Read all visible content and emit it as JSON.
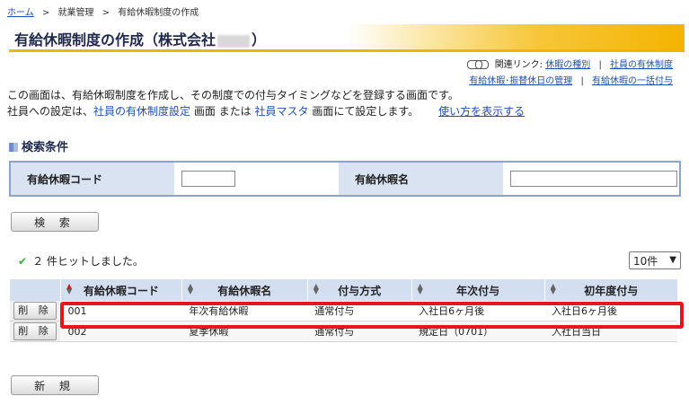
{
  "breadcrumb": {
    "home": "ホーム",
    "sep": ">",
    "level1": "就業管理",
    "current": "有給休暇制度の作成"
  },
  "header": {
    "title_prefix": "有給休暇制度の作成（株式会社",
    "title_suffix": "）"
  },
  "related": {
    "label": "関連リンク:",
    "links": [
      "休暇の種別",
      "社員の有休制度",
      "有給休暇･振替休日の管理",
      "有給休暇の一括付与"
    ],
    "separator": "|"
  },
  "description": {
    "line1": "この画面は、有給休暇制度を作成し、その制度での付与タイミングなどを登録する画面です。",
    "line2_a": "社員への設定は、",
    "line2_link1": "社員の有休制度設定",
    "line2_b": " 画面 または ",
    "line2_link2": "社員マスタ",
    "line2_c": " 画面にて設定します。",
    "howto": "使い方を表示する"
  },
  "search": {
    "section_title": "検索条件",
    "code_label": "有給休暇コード",
    "code_value": "",
    "name_label": "有給休暇名",
    "name_value": "",
    "search_button": "検 索"
  },
  "results": {
    "hit_text": "２ 件ヒットしました。",
    "per_page": "10件",
    "columns": [
      "有給休暇コード",
      "有給休暇名",
      "付与方式",
      "年次付与",
      "初年度付与"
    ],
    "delete_label": "削 除",
    "rows": [
      {
        "code": "001",
        "name": "年次有給休暇",
        "method": "通常付与",
        "annual": "入社日6ヶ月後",
        "first_year": "入社日6ヶ月後"
      },
      {
        "code": "002",
        "name": "夏季休暇",
        "method": "通常付与",
        "annual": "規定日（0701）",
        "first_year": "入社日当日"
      }
    ]
  },
  "footer": {
    "new_button": "新 規"
  },
  "colors": {
    "accent": "#f4b400",
    "header_bg": "#d3dff0",
    "highlight": "#e8151f",
    "link": "#1f4fb3"
  }
}
